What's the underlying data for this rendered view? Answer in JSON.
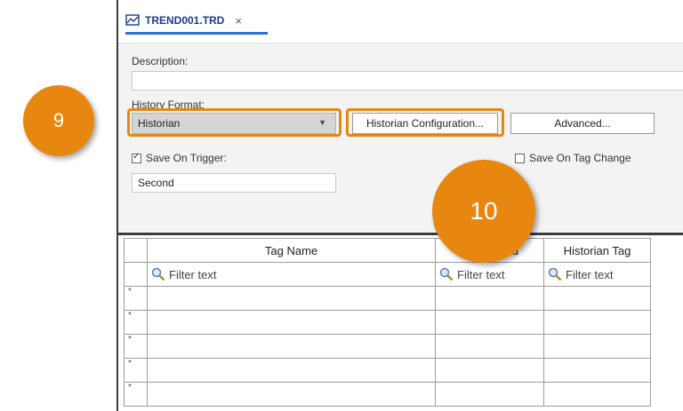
{
  "tab": {
    "title": "TREND001.TRD",
    "close": "×"
  },
  "form": {
    "description_label": "Description:",
    "description_value": "",
    "history_format_label": "History Format:",
    "history_format_value": "Historian",
    "historian_config_button": "Historian Configuration...",
    "advanced_button": "Advanced...",
    "save_on_trigger_label": "Save On Trigger:",
    "save_on_trigger_checked": true,
    "save_on_tag_change_label": "Save On Tag Change",
    "save_on_tag_change_checked": false,
    "unit_value": "Second"
  },
  "grid": {
    "columns": [
      "Tag Name",
      "Dead Band",
      "Historian Tag"
    ],
    "filter_placeholder": "Filter text",
    "new_row_marker": "*",
    "row_count": 5
  },
  "callouts": {
    "first": "9",
    "second": "10"
  },
  "colors": {
    "accent": "#e8870f",
    "tab_underline": "#2f6fd6",
    "tab_text": "#1a3d8f"
  }
}
